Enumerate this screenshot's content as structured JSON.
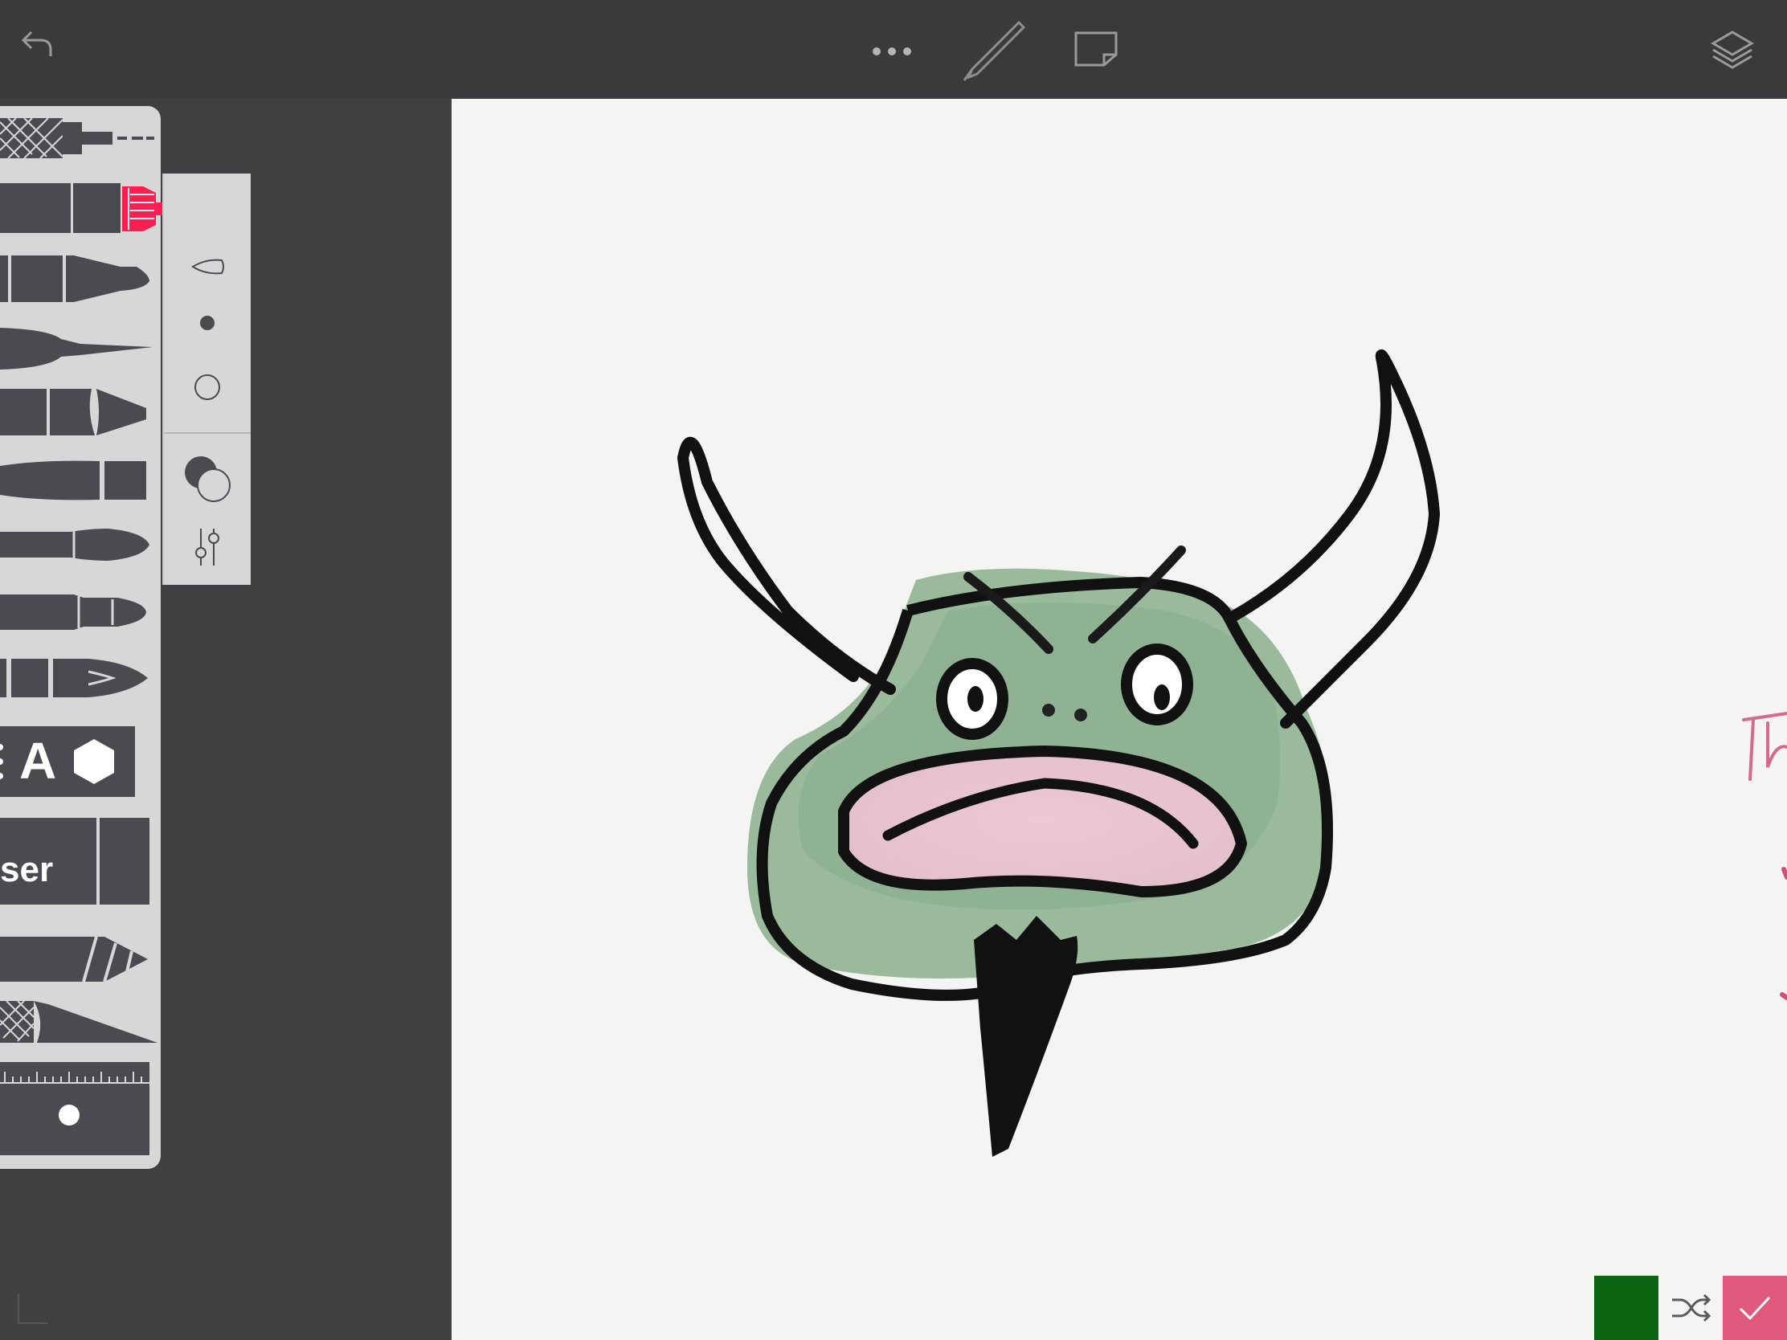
{
  "toolbar": {
    "undo_icon": "undo-arrow-icon",
    "more_icon": "more-dots-icon",
    "pen_icon": "pen-icon",
    "paper_icon": "paper-icon",
    "layers_icon": "layers-icon"
  },
  "tools": {
    "items": [
      "pencil",
      "technical-pen",
      "marker",
      "brush",
      "crayon",
      "fat-brush",
      "watercolor-brush",
      "fine-brush",
      "fountain-pen",
      "text-tool",
      "eraser",
      "cutter-knife",
      "knife",
      "ruler"
    ],
    "text_tool_letter": "A",
    "eraser_label": "ser",
    "active_tool": "technical-pen",
    "active_color": "#ff1e50"
  },
  "side_panel": {
    "items": [
      "brush-shape-icon",
      "small-dot-icon",
      "outline-circle-icon",
      "blend-mode-icon",
      "settings-sliders-icon"
    ]
  },
  "canvas": {
    "edge_text": "Th"
  },
  "bottom": {
    "color_swatch": "#0b6512",
    "shuffle_icon": "shuffle-icon",
    "confirm_icon": "checkmark-icon",
    "confirm_color": "#e05a7d"
  }
}
